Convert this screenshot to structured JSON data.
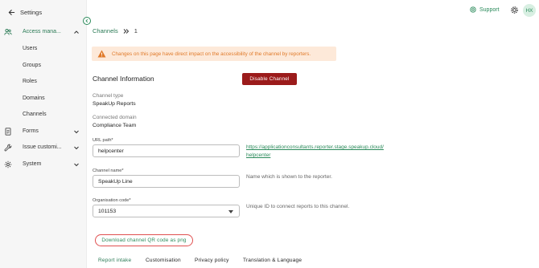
{
  "sidebar": {
    "back_label": "Settings",
    "items": [
      {
        "label": "Access mana...",
        "icon": "users-icon",
        "expanded": true
      },
      {
        "label": "Forms",
        "icon": "document-icon",
        "expanded": false
      },
      {
        "label": "Issue customi...",
        "icon": "wrench-icon",
        "expanded": false
      },
      {
        "label": "System",
        "icon": "gear-icon",
        "expanded": false
      }
    ],
    "sub_items": [
      "Users",
      "Groups",
      "Roles",
      "Domains",
      "Channels"
    ]
  },
  "header": {
    "support_label": "Support",
    "avatar_initials": "HX"
  },
  "breadcrumb": {
    "parent": "Channels",
    "current": "1"
  },
  "warning": {
    "text": "Changes on this page have direct impact on the accessibility of the channel by reporters."
  },
  "channel_info": {
    "title": "Channel Information",
    "disable_label": "Disable Channel",
    "type_label": "Channel type",
    "type_value": "SpeakUp Reports",
    "domain_label": "Connected domain",
    "domain_value": "Compliance Team"
  },
  "form": {
    "url_path_label": "URL path*",
    "url_path_value": "helpcenter",
    "url_link_line1": "https://applicationconsultants.reporter.stage.speakup.cloud/",
    "url_link_line2": "helpcenter",
    "channel_name_label": "Channel name*",
    "channel_name_value": "SpeakUp Line",
    "channel_name_hint": "Name which is shown to the reporter.",
    "org_code_label": "Organisation code*",
    "org_code_value": "101153",
    "org_code_hint": "Unique ID to connect reports to this channel."
  },
  "qr_button_label": "Download channel QR code as png",
  "tabs": [
    "Report intake",
    "Customisation",
    "Privacy policy",
    "Translation & Language"
  ],
  "colors": {
    "accent": "#2a8a5a",
    "danger": "#9b1b1b",
    "warning_bg": "#fde9d9",
    "warning_text": "#e07a2a"
  }
}
